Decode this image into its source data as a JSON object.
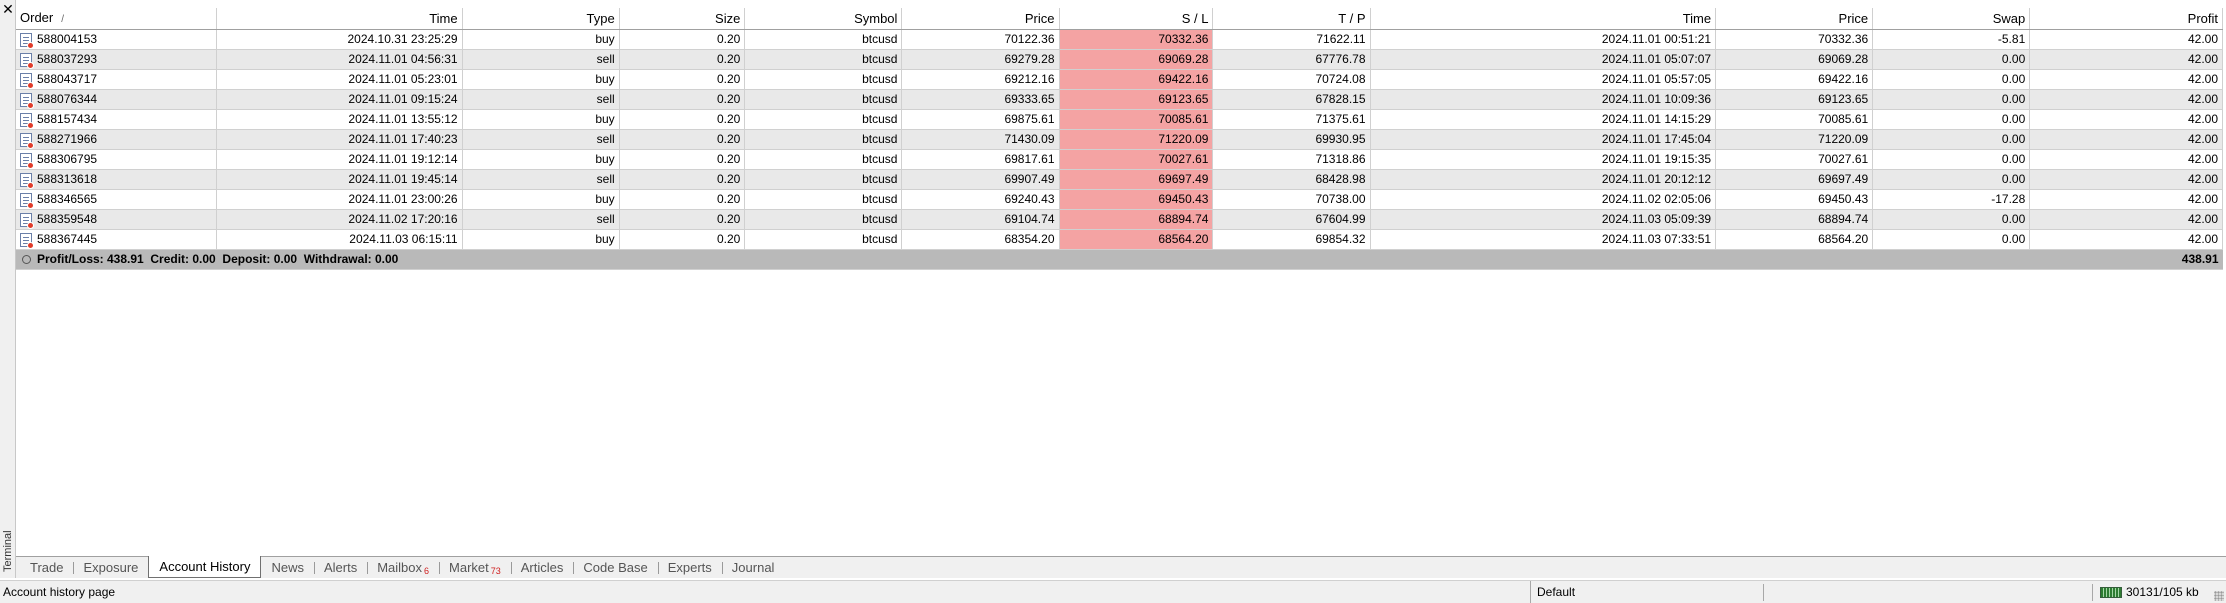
{
  "window": {
    "close_glyph": "✕",
    "side_label": "Terminal"
  },
  "columns": [
    {
      "label": "Order",
      "align": "l"
    },
    {
      "label": "Time",
      "align": "r"
    },
    {
      "label": "Type",
      "align": "r"
    },
    {
      "label": "Size",
      "align": "r"
    },
    {
      "label": "Symbol",
      "align": "r"
    },
    {
      "label": "Price",
      "align": "r"
    },
    {
      "label": "S / L",
      "align": "r"
    },
    {
      "label": "T / P",
      "align": "r"
    },
    {
      "label": "Time",
      "align": "r"
    },
    {
      "label": "Price",
      "align": "r"
    },
    {
      "label": "Swap",
      "align": "r"
    },
    {
      "label": "Profit",
      "align": "r"
    }
  ],
  "sort_indicator": "/",
  "rows": [
    [
      "588004153",
      "2024.10.31 23:25:29",
      "buy",
      "0.20",
      "btcusd",
      "70122.36",
      "70332.36",
      "71622.11",
      "2024.11.01 00:51:21",
      "70332.36",
      "-5.81",
      "42.00"
    ],
    [
      "588037293",
      "2024.11.01 04:56:31",
      "sell",
      "0.20",
      "btcusd",
      "69279.28",
      "69069.28",
      "67776.78",
      "2024.11.01 05:07:07",
      "69069.28",
      "0.00",
      "42.00"
    ],
    [
      "588043717",
      "2024.11.01 05:23:01",
      "buy",
      "0.20",
      "btcusd",
      "69212.16",
      "69422.16",
      "70724.08",
      "2024.11.01 05:57:05",
      "69422.16",
      "0.00",
      "42.00"
    ],
    [
      "588076344",
      "2024.11.01 09:15:24",
      "sell",
      "0.20",
      "btcusd",
      "69333.65",
      "69123.65",
      "67828.15",
      "2024.11.01 10:09:36",
      "69123.65",
      "0.00",
      "42.00"
    ],
    [
      "588157434",
      "2024.11.01 13:55:12",
      "buy",
      "0.20",
      "btcusd",
      "69875.61",
      "70085.61",
      "71375.61",
      "2024.11.01 14:15:29",
      "70085.61",
      "0.00",
      "42.00"
    ],
    [
      "588271966",
      "2024.11.01 17:40:23",
      "sell",
      "0.20",
      "btcusd",
      "71430.09",
      "71220.09",
      "69930.95",
      "2024.11.01 17:45:04",
      "71220.09",
      "0.00",
      "42.00"
    ],
    [
      "588306795",
      "2024.11.01 19:12:14",
      "buy",
      "0.20",
      "btcusd",
      "69817.61",
      "70027.61",
      "71318.86",
      "2024.11.01 19:15:35",
      "70027.61",
      "0.00",
      "42.00"
    ],
    [
      "588313618",
      "2024.11.01 19:45:14",
      "sell",
      "0.20",
      "btcusd",
      "69907.49",
      "69697.49",
      "68428.98",
      "2024.11.01 20:12:12",
      "69697.49",
      "0.00",
      "42.00"
    ],
    [
      "588346565",
      "2024.11.01 23:00:26",
      "buy",
      "0.20",
      "btcusd",
      "69240.43",
      "69450.43",
      "70738.00",
      "2024.11.02 02:05:06",
      "69450.43",
      "-17.28",
      "42.00"
    ],
    [
      "588359548",
      "2024.11.02 17:20:16",
      "sell",
      "0.20",
      "btcusd",
      "69104.74",
      "68894.74",
      "67604.99",
      "2024.11.03 05:09:39",
      "68894.74",
      "0.00",
      "42.00"
    ],
    [
      "588367445",
      "2024.11.03 06:15:11",
      "buy",
      "0.20",
      "btcusd",
      "68354.20",
      "68564.20",
      "69854.32",
      "2024.11.03 07:33:51",
      "68564.20",
      "0.00",
      "42.00"
    ]
  ],
  "row_icon": "document-with-red-dot-icon",
  "summary": {
    "text": "Profit/Loss: 438.91  Credit: 0.00  Deposit: 0.00  Withdrawal: 0.00",
    "total": "438.91"
  },
  "tabs": [
    {
      "label": "Trade",
      "badge": "",
      "active": false
    },
    {
      "label": "Exposure",
      "badge": "",
      "active": false
    },
    {
      "label": "Account History",
      "badge": "",
      "active": true
    },
    {
      "label": "News",
      "badge": "",
      "active": false
    },
    {
      "label": "Alerts",
      "badge": "",
      "active": false
    },
    {
      "label": "Mailbox",
      "badge": "6",
      "active": false
    },
    {
      "label": "Market",
      "badge": "73",
      "active": false
    },
    {
      "label": "Articles",
      "badge": "",
      "active": false
    },
    {
      "label": "Code Base",
      "badge": "",
      "active": false
    },
    {
      "label": "Experts",
      "badge": "",
      "active": false
    },
    {
      "label": "Journal",
      "badge": "",
      "active": false
    }
  ],
  "status": {
    "left_text": "Account history page",
    "profile": "Default",
    "traffic": "30131/105 kb"
  },
  "colors": {
    "sl_highlight": "#f4a3a3",
    "row_alt": "#e9e9e9",
    "summary_bg": "#b9b9b9",
    "badge": "#d02020"
  }
}
